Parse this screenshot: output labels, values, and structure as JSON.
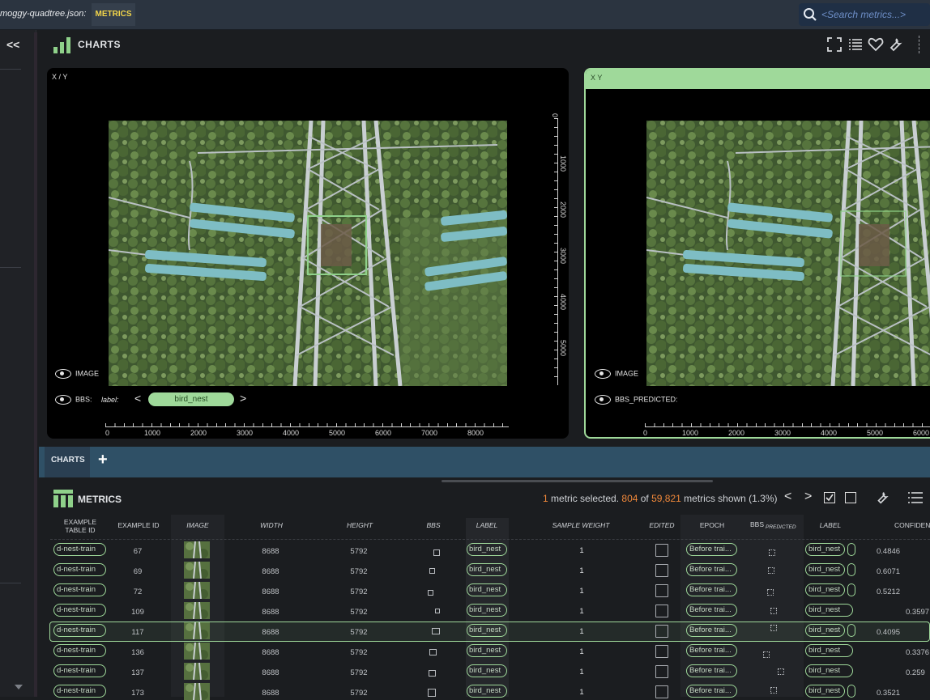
{
  "topbar": {
    "file_name": "moggy-quadtree.json:",
    "active_tab": "METRICS",
    "search_placeholder": "<Search metrics...>"
  },
  "charts": {
    "title": "CHARTS",
    "panels": [
      {
        "title": "X / Y",
        "image_label": "IMAGE",
        "bbs_label": "BBS:",
        "bbs_field": "label:",
        "bbs_value": "bird_nest",
        "x_ticks": [
          "0",
          "1000",
          "2000",
          "3000",
          "4000",
          "5000",
          "6000",
          "7000",
          "8000"
        ],
        "y_ticks": [
          "0",
          "1000",
          "2000",
          "3000",
          "4000",
          "5000"
        ]
      },
      {
        "title": "X  Y",
        "image_label": "IMAGE",
        "bbs_label": "BBS_PREDICTED:",
        "x_ticks": [
          "0",
          "1000",
          "2000",
          "3000",
          "4000",
          "5000",
          "6000"
        ]
      }
    ],
    "tabs": {
      "charts_tab": "CHARTS",
      "add_tab": "+"
    }
  },
  "metrics": {
    "title": "METRICS",
    "summary": {
      "selected_count": "1",
      "selected_text": " metric selected. ",
      "shown": "804",
      "of": " of ",
      "total": "59,821",
      "tail": " metrics shown (1.3%)"
    },
    "columns": [
      "EXAMPLE TABLE ID",
      "EXAMPLE ID",
      "IMAGE",
      "WIDTH",
      "HEIGHT",
      "BBS",
      "LABEL",
      "SAMPLE WEIGHT",
      "EDITED",
      "EPOCH",
      "BBS",
      "PREDICTED",
      "LABEL",
      "CONFIDEN"
    ],
    "rows": [
      {
        "table_id": "d-nest-train",
        "example_id": "67",
        "width": "8688",
        "height": "5792",
        "label": "bird_nest",
        "weight": "1",
        "epoch": "Before trai...",
        "pred_label": "bird_nest",
        "confidence": "0.4846"
      },
      {
        "table_id": "d-nest-train",
        "example_id": "69",
        "width": "8688",
        "height": "5792",
        "label": "bird_nest",
        "weight": "1",
        "epoch": "Before trai...",
        "pred_label": "bird_nest",
        "confidence": "0.6071"
      },
      {
        "table_id": "d-nest-train",
        "example_id": "72",
        "width": "8688",
        "height": "5792",
        "label": "bird_nest",
        "weight": "1",
        "epoch": "Before trai...",
        "pred_label": "bird_nest",
        "confidence": "0.5212"
      },
      {
        "table_id": "d-nest-train",
        "example_id": "109",
        "width": "8688",
        "height": "5792",
        "label": "bird_nest",
        "weight": "1",
        "epoch": "Before trai...",
        "pred_label": "bird_nest",
        "confidence": "0.3597"
      },
      {
        "table_id": "d-nest-train",
        "example_id": "117",
        "width": "8688",
        "height": "5792",
        "label": "bird_nest",
        "weight": "1",
        "epoch": "Before trai...",
        "pred_label": "bird_nest",
        "confidence": "0.4095"
      },
      {
        "table_id": "d-nest-train",
        "example_id": "136",
        "width": "8688",
        "height": "5792",
        "label": "bird_nest",
        "weight": "1",
        "epoch": "Before trai...",
        "pred_label": "bird_nest",
        "confidence": "0.3376"
      },
      {
        "table_id": "d-nest-train",
        "example_id": "137",
        "width": "8688",
        "height": "5792",
        "label": "bird_nest",
        "weight": "1",
        "epoch": "Before trai...",
        "pred_label": "bird_nest",
        "confidence": "0.259"
      },
      {
        "table_id": "d-nest-train",
        "example_id": "173",
        "width": "8688",
        "height": "5792",
        "label": "bird_nest",
        "weight": "1",
        "epoch": "Before trai...",
        "pred_label": "bird_nest",
        "confidence": "0.3521"
      }
    ]
  },
  "colors": {
    "accent_green": "#9fd99a",
    "highlight_orange": "#f0883a",
    "metrics_tab_text": "#f2d54a"
  }
}
